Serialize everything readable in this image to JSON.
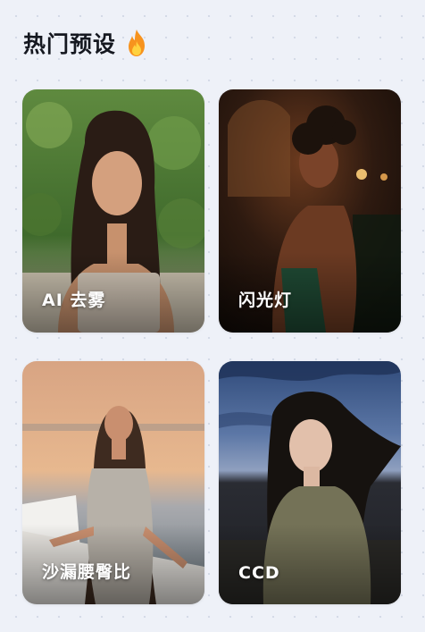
{
  "section": {
    "title": "热门预设",
    "title_icon": "fire-icon"
  },
  "presets": [
    {
      "label": "AI 去雾"
    },
    {
      "label": "闪光灯"
    },
    {
      "label": "沙漏腰臀比"
    },
    {
      "label": "CCD"
    }
  ],
  "colors": {
    "background": "#eef1f8",
    "title": "#151820",
    "card_label": "#ffffff",
    "fire_outer": "#f7931e",
    "fire_inner": "#ffd23f"
  }
}
